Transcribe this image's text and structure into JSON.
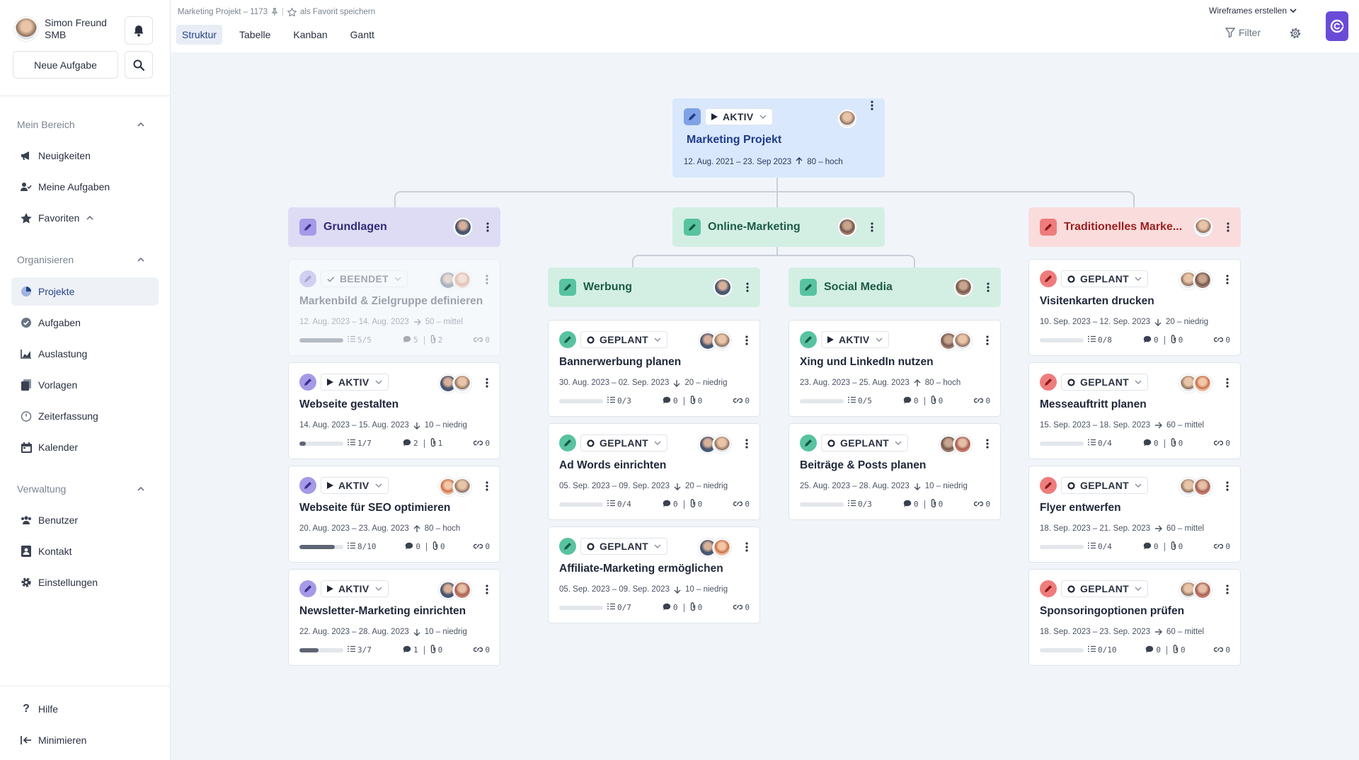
{
  "user": {
    "name": "Simon Freund",
    "role": "SMB"
  },
  "sidebar": {
    "new_task": "Neue Aufgabe",
    "sections": [
      {
        "title": "Mein Bereich",
        "items": [
          {
            "label": "Neuigkeiten",
            "icon": "megaphone-icon"
          },
          {
            "label": "Meine Aufgaben",
            "icon": "user-tasks-icon"
          },
          {
            "label": "Favoriten",
            "icon": "star-icon"
          }
        ]
      },
      {
        "title": "Organisieren",
        "items": [
          {
            "label": "Projekte",
            "icon": "pie-chart-icon"
          },
          {
            "label": "Aufgaben",
            "icon": "check-circle-icon"
          },
          {
            "label": "Auslastung",
            "icon": "area-chart-icon"
          },
          {
            "label": "Vorlagen",
            "icon": "template-icon"
          },
          {
            "label": "Zeiterfassung",
            "icon": "stopwatch-icon"
          },
          {
            "label": "Kalender",
            "icon": "calendar-icon"
          }
        ]
      },
      {
        "title": "Verwaltung",
        "items": [
          {
            "label": "Benutzer",
            "icon": "users-icon"
          },
          {
            "label": "Kontakt",
            "icon": "contact-icon"
          },
          {
            "label": "Einstellungen",
            "icon": "gear-icon"
          }
        ]
      }
    ],
    "footer": [
      {
        "label": "Hilfe",
        "icon": "help-icon"
      },
      {
        "label": "Minimieren",
        "icon": "collapse-icon"
      }
    ]
  },
  "header": {
    "breadcrumb": "Marketing Projekt – 1173",
    "favorite": "als Favorit speichern",
    "tabs": [
      "Struktur",
      "Tabelle",
      "Kanban",
      "Gantt"
    ],
    "active_tab": "Struktur",
    "wireframes": "Wireframes erstellen",
    "filter": "Filter"
  },
  "colors": {
    "accent": "#26448b",
    "purple": "#7b6fd6",
    "green": "#3fb592",
    "red": "#e24a4a",
    "brand": "#6a4bd8"
  },
  "root": {
    "status": "AKTIV",
    "title": "Marketing Projekt",
    "dates": "12. Aug. 2021 – 23. Sep 2023",
    "priority": "80 – hoch"
  },
  "groups": [
    {
      "title": "Grundlagen",
      "theme": "purple"
    },
    {
      "title": "Online-Marketing",
      "theme": "green"
    },
    {
      "title": "Traditionelles Marke...",
      "theme": "red"
    },
    {
      "title": "Werbung",
      "theme": "green"
    },
    {
      "title": "Social Media",
      "theme": "green"
    }
  ],
  "tasks": [
    {
      "status": "BEENDET",
      "title": "Markenbild & Zielgruppe definieren",
      "dates": "12. Aug. 2023 – 14. Aug. 2023",
      "priority": "50 – mittel",
      "dir": "right",
      "checklist": "5/5",
      "progress": 1.0,
      "comments": "5",
      "attachments": "2",
      "links": "0",
      "done": true,
      "theme": "purple"
    },
    {
      "status": "AKTIV",
      "title": "Webseite gestalten",
      "dates": "14. Aug. 2023 – 15. Aug. 2023",
      "priority": "10 – niedrig",
      "dir": "down",
      "checklist": "1/7",
      "progress": 0.14,
      "comments": "2",
      "attachments": "1",
      "links": "0",
      "theme": "purple"
    },
    {
      "status": "AKTIV",
      "title": "Webseite für SEO optimieren",
      "dates": "20. Aug. 2023 – 23. Aug. 2023",
      "priority": "80 – hoch",
      "dir": "up",
      "checklist": "8/10",
      "progress": 0.8,
      "comments": "0",
      "attachments": "0",
      "links": "0",
      "theme": "purple"
    },
    {
      "status": "AKTIV",
      "title": "Newsletter-Marketing einrichten",
      "dates": "22. Aug. 2023 – 28. Aug. 2023",
      "priority": "10 – niedrig",
      "dir": "down",
      "checklist": "3/7",
      "progress": 0.43,
      "comments": "1",
      "attachments": "0",
      "links": "0",
      "theme": "purple"
    },
    {
      "status": "GEPLANT",
      "title": "Bannerwerbung planen",
      "dates": "30. Aug. 2023 – 02. Sep. 2023",
      "priority": "20 – niedrig",
      "dir": "down",
      "checklist": "0/3",
      "progress": 0,
      "comments": "0",
      "attachments": "0",
      "links": "0",
      "theme": "green"
    },
    {
      "status": "GEPLANT",
      "title": "Ad Words einrichten",
      "dates": "05. Sep. 2023 – 09. Sep. 2023",
      "priority": "20 – niedrig",
      "dir": "down",
      "checklist": "0/4",
      "progress": 0,
      "comments": "0",
      "attachments": "0",
      "links": "0",
      "theme": "green"
    },
    {
      "status": "GEPLANT",
      "title": "Affiliate-Marketing ermöglichen",
      "dates": "05. Sep. 2023 – 09. Sep. 2023",
      "priority": "10 – niedrig",
      "dir": "down",
      "checklist": "0/7",
      "progress": 0,
      "comments": "0",
      "attachments": "0",
      "links": "0",
      "theme": "green"
    },
    {
      "status": "AKTIV",
      "title": "Xing und LinkedIn nutzen",
      "dates": "23. Aug. 2023 – 25. Aug. 2023",
      "priority": "80 – hoch",
      "dir": "up",
      "checklist": "0/5",
      "progress": 0,
      "comments": "0",
      "attachments": "0",
      "links": "0",
      "theme": "green"
    },
    {
      "status": "GEPLANT",
      "title": "Beiträge & Posts planen",
      "dates": "25. Aug. 2023 – 28. Aug. 2023",
      "priority": "10 – niedrig",
      "dir": "down",
      "checklist": "0/3",
      "progress": 0,
      "comments": "0",
      "attachments": "0",
      "links": "0",
      "theme": "green"
    },
    {
      "status": "GEPLANT",
      "title": "Visitenkarten drucken",
      "dates": "10. Sep. 2023 – 12. Sep. 2023",
      "priority": "20 – niedrig",
      "dir": "down",
      "checklist": "0/8",
      "progress": 0,
      "comments": "0",
      "attachments": "0",
      "links": "0",
      "theme": "red"
    },
    {
      "status": "GEPLANT",
      "title": "Messeauftritt planen",
      "dates": "15. Sep. 2023 – 18. Sep. 2023",
      "priority": "60 – mittel",
      "dir": "right",
      "checklist": "0/4",
      "progress": 0,
      "comments": "0",
      "attachments": "0",
      "links": "0",
      "theme": "red"
    },
    {
      "status": "GEPLANT",
      "title": "Flyer entwerfen",
      "dates": "18. Sep. 2023 – 21. Sep. 2023",
      "priority": "60 – mittel",
      "dir": "right",
      "checklist": "0/4",
      "progress": 0,
      "comments": "0",
      "attachments": "0",
      "links": "0",
      "theme": "red"
    },
    {
      "status": "GEPLANT",
      "title": "Sponsoringoptionen prüfen",
      "dates": "18. Sep. 2023 – 23. Sep. 2023",
      "priority": "60 – mittel",
      "dir": "right",
      "checklist": "0/10",
      "progress": 0,
      "comments": "0",
      "attachments": "0",
      "links": "0",
      "theme": "red"
    }
  ]
}
